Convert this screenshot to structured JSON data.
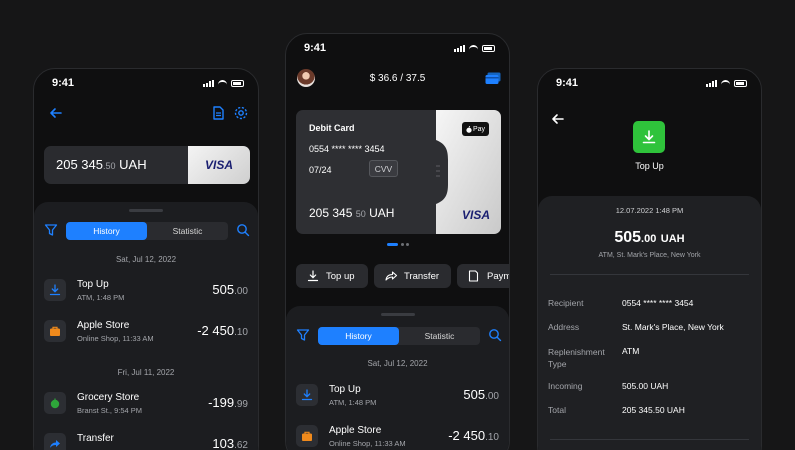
{
  "status": {
    "time": "9:41"
  },
  "left": {
    "balance_main": "205 345",
    "balance_cents": ".50",
    "balance_currency": "UAH",
    "card_brand": "VISA",
    "tabs": [
      "History",
      "Statistic"
    ],
    "groups": [
      {
        "date": "Sat, Jul 12, 2022",
        "items": [
          {
            "name": "Top Up",
            "sub": "ATM, 1:48 PM",
            "amount": "505",
            "cents": ".00",
            "icon": "download-icon"
          },
          {
            "name": "Apple Store",
            "sub": "Online Shop, 11:33 AM",
            "amount": "-2 450",
            "cents": ".10",
            "icon": "bag-icon"
          }
        ]
      },
      {
        "date": "Fri, Jul 11, 2022",
        "items": [
          {
            "name": "Grocery Store",
            "sub": "Branst St., 9:54 PM",
            "amount": "-199",
            "cents": ".99",
            "icon": "apple-icon"
          },
          {
            "name": "Transfer",
            "sub": "",
            "amount": "103",
            "cents": ".62",
            "icon": "share-icon"
          }
        ]
      }
    ]
  },
  "center": {
    "header_amount": "$ 36.6 / 37.5",
    "card_title": "Debit Card",
    "card_number": "0554 **** **** 3454",
    "expiry": "07/24",
    "cvv_label": "CVV",
    "balance_main": "205 345",
    "balance_cents": "50",
    "balance_currency": "UAH",
    "pay_badge": "Pay",
    "card_brand": "VISA",
    "actions": [
      "Top up",
      "Transfer",
      "Paym"
    ],
    "tabs": [
      "History",
      "Statistic"
    ],
    "groups": [
      {
        "date": "Sat, Jul 12, 2022",
        "items": [
          {
            "name": "Top Up",
            "sub": "ATM, 1:48 PM",
            "amount": "505",
            "cents": ".00",
            "icon": "download-icon"
          },
          {
            "name": "Apple Store",
            "sub": "Online Shop, 11:33 AM",
            "amount": "-2 450",
            "cents": ".10",
            "icon": "bag-icon"
          }
        ]
      }
    ]
  },
  "right": {
    "title": "Top Up",
    "datetime": "12.07.2022 1:48 PM",
    "amount_main": "505",
    "amount_cents": ".00",
    "amount_currency": "UAH",
    "location": "ATM, St. Mark's Place, New York",
    "details": [
      {
        "label": "Recipient",
        "value": "0554 **** **** 3454"
      },
      {
        "label": "Address",
        "value": "St. Mark's Place, New York"
      },
      {
        "label": "Replenishment Type",
        "value": "ATM"
      },
      {
        "label": "Incoming",
        "value": "505.00 UAH"
      },
      {
        "label": "Total",
        "value": "205 345.50 UAH"
      }
    ]
  },
  "colors": {
    "accent": "#1e80ff",
    "success": "#2fc33b",
    "orange": "#f08a1c",
    "green": "#2ea63a"
  }
}
